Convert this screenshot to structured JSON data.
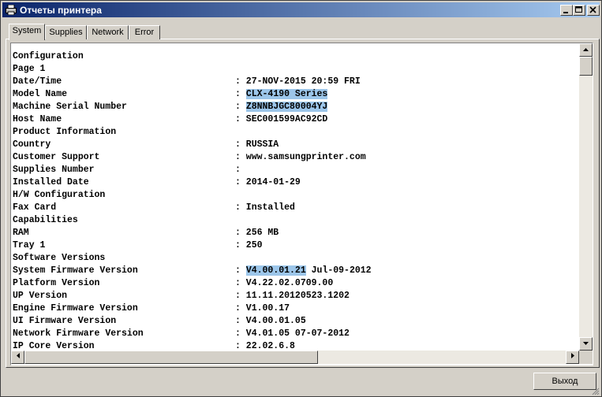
{
  "window": {
    "title": "Отчеты принтера"
  },
  "tabs": [
    {
      "label": "System",
      "active": true
    },
    {
      "label": "Supplies",
      "active": false
    },
    {
      "label": "Network",
      "active": false
    },
    {
      "label": "Error",
      "active": false
    }
  ],
  "report": {
    "lines": [
      {
        "label": "Configuration",
        "value": ""
      },
      {
        "label": "Page 1",
        "value": ""
      },
      {
        "label": "Date/Time",
        "value": ": 27-NOV-2015 20:59 FRI"
      },
      {
        "label": "Model Name",
        "sep": ": ",
        "highlight": "CLX-4190 Series",
        "rest": ""
      },
      {
        "label": "Machine Serial Number",
        "sep": ": ",
        "highlight": "Z8NNBJGC80004YJ",
        "rest": ""
      },
      {
        "label": "Host Name",
        "value": ": SEC001599AC92CD"
      },
      {
        "label": "Product Information",
        "value": ""
      },
      {
        "label": "Country",
        "value": ": RUSSIA"
      },
      {
        "label": "Customer Support",
        "value": ": www.samsungprinter.com"
      },
      {
        "label": "Supplies Number",
        "value": ":"
      },
      {
        "label": "Installed Date",
        "value": ": 2014-01-29"
      },
      {
        "label": "H/W Configuration",
        "value": ""
      },
      {
        "label": "Fax Card",
        "value": ": Installed"
      },
      {
        "label": "Capabilities",
        "value": ""
      },
      {
        "label": "RAM",
        "value": ": 256 MB"
      },
      {
        "label": "Tray 1",
        "value": ": 250"
      },
      {
        "label": "Software Versions",
        "value": ""
      },
      {
        "label": "System Firmware Version",
        "sep": ": ",
        "highlight": "V4.00.01.21",
        "rest": " Jul-09-2012"
      },
      {
        "label": "Platform Version",
        "value": ": V4.22.02.0709.00"
      },
      {
        "label": "UP Version",
        "value": ": 11.11.20120523.1202"
      },
      {
        "label": "Engine Firmware Version",
        "value": ": V1.00.17"
      },
      {
        "label": "UI Firmware Version",
        "value": ": V4.00.01.05"
      },
      {
        "label": "Network Firmware Version",
        "value": ": V4.01.05 07-07-2012"
      },
      {
        "label": "IP Core Version",
        "value": ": 22.02.6.8"
      }
    ]
  },
  "scroll": {
    "vertical_fraction": 0.0,
    "horizontal_fraction": 0.0
  },
  "footer": {
    "exit_label": "Выход"
  }
}
